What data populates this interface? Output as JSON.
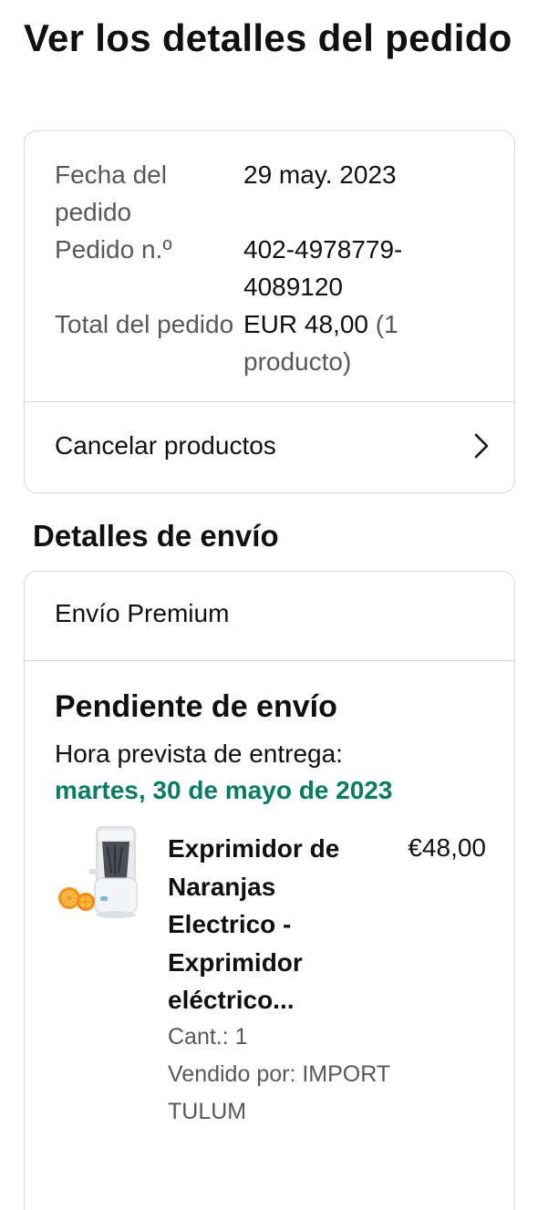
{
  "page": {
    "title": "Ver los detalles del pedido"
  },
  "summary": {
    "rows": [
      {
        "label": "Fecha del pedido",
        "value": "29 may. 2023"
      },
      {
        "label": "Pedido n.º",
        "value": "402-4978779-4089120"
      },
      {
        "label": "Total del pedido",
        "value": "EUR 48,00",
        "value_suffix": "(1 producto)"
      }
    ],
    "cancel_label": "Cancelar productos"
  },
  "shipping": {
    "section_title": "Detalles de envío",
    "method": "Envío Premium",
    "status": "Pendiente de envío",
    "eta_label": "Hora prevista de entrega:",
    "eta_date": "martes, 30 de mayo de 2023",
    "eta_color": "#067d62",
    "product": {
      "name": "Exprimidor de Naranjas Electrico - Exprimidor eléctrico...",
      "price": "€48,00",
      "quantity": "Cant.: 1",
      "seller": "Vendido por: IMPORT TULUM",
      "image_icon": "juicer-product-image"
    }
  }
}
